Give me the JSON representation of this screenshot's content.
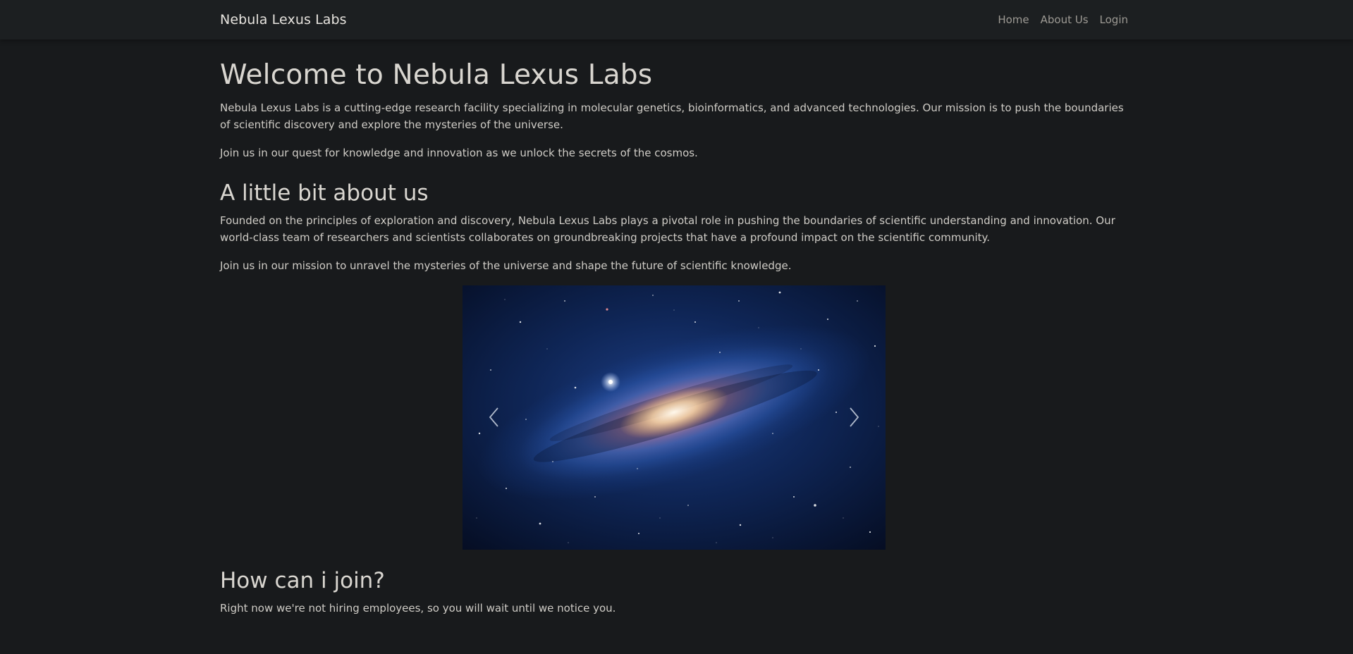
{
  "navbar": {
    "brand": "Nebula Lexus Labs",
    "links": [
      {
        "label": "Home"
      },
      {
        "label": "About Us"
      },
      {
        "label": "Login"
      }
    ]
  },
  "welcome": {
    "title": "Welcome to Nebula Lexus Labs",
    "paragraphs": [
      "Nebula Lexus Labs is a cutting-edge research facility specializing in molecular genetics, bioinformatics, and advanced technologies. Our mission is to push the boundaries of scientific discovery and explore the mysteries of the universe.",
      "Join us in our quest for knowledge and innovation as we unlock the secrets of the cosmos."
    ]
  },
  "about": {
    "title": "A little bit about us",
    "paragraphs": [
      "Founded on the principles of exploration and discovery, Nebula Lexus Labs plays a pivotal role in pushing the boundaries of scientific understanding and innovation. Our world-class team of researchers and scientists collaborates on groundbreaking projects that have a profound impact on the scientific community.",
      "Join us in our mission to unravel the mysteries of the universe and shape the future of scientific knowledge."
    ]
  },
  "carousel": {
    "prev_icon": "chevron-left-icon",
    "next_icon": "chevron-right-icon"
  },
  "join": {
    "title": "How can i join?",
    "text": "Right now we're not hiring employees, so you will wait until we notice you."
  },
  "colors": {
    "background": "#181a1c",
    "navbar": "#1c1f21",
    "text": "#cfccc6",
    "nav_link": "#9d9a94"
  }
}
